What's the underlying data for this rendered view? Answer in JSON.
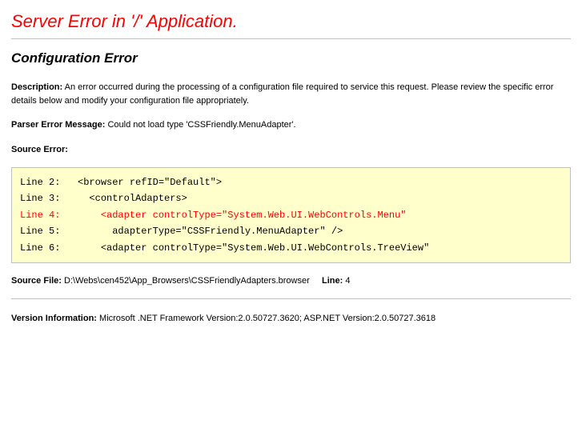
{
  "header": {
    "title": "Server Error in '/' Application."
  },
  "subheader": {
    "title": "Configuration Error"
  },
  "description": {
    "label": "Description:",
    "text": "An error occurred during the processing of a configuration file required to service this request. Please review the specific error details below and modify your configuration file appropriately."
  },
  "parserError": {
    "label": "Parser Error Message:",
    "text": "Could not load type 'CSSFriendly.MenuAdapter'."
  },
  "sourceError": {
    "label": "Source Error:"
  },
  "codeLines": [
    {
      "no": "Line 2:",
      "code": "  <browser refID=\"Default\">",
      "hl": false
    },
    {
      "no": "Line 3:",
      "code": "    <controlAdapters>",
      "hl": false
    },
    {
      "no": "Line 4:",
      "code": "      <adapter controlType=\"System.Web.UI.WebControls.Menu\"",
      "hl": true
    },
    {
      "no": "Line 5:",
      "code": "        adapterType=\"CSSFriendly.MenuAdapter\" />",
      "hl": false
    },
    {
      "no": "Line 6:",
      "code": "      <adapter controlType=\"System.Web.UI.WebControls.TreeView\"",
      "hl": false
    }
  ],
  "sourceFile": {
    "label": "Source File:",
    "text": "D:\\Webs\\cen452\\App_Browsers\\CSSFriendlyAdapters.browser",
    "lineLabel": "Line:",
    "lineNo": "4"
  },
  "version": {
    "label": "Version Information:",
    "text": "Microsoft .NET Framework Version:2.0.50727.3620; ASP.NET Version:2.0.50727.3618"
  }
}
